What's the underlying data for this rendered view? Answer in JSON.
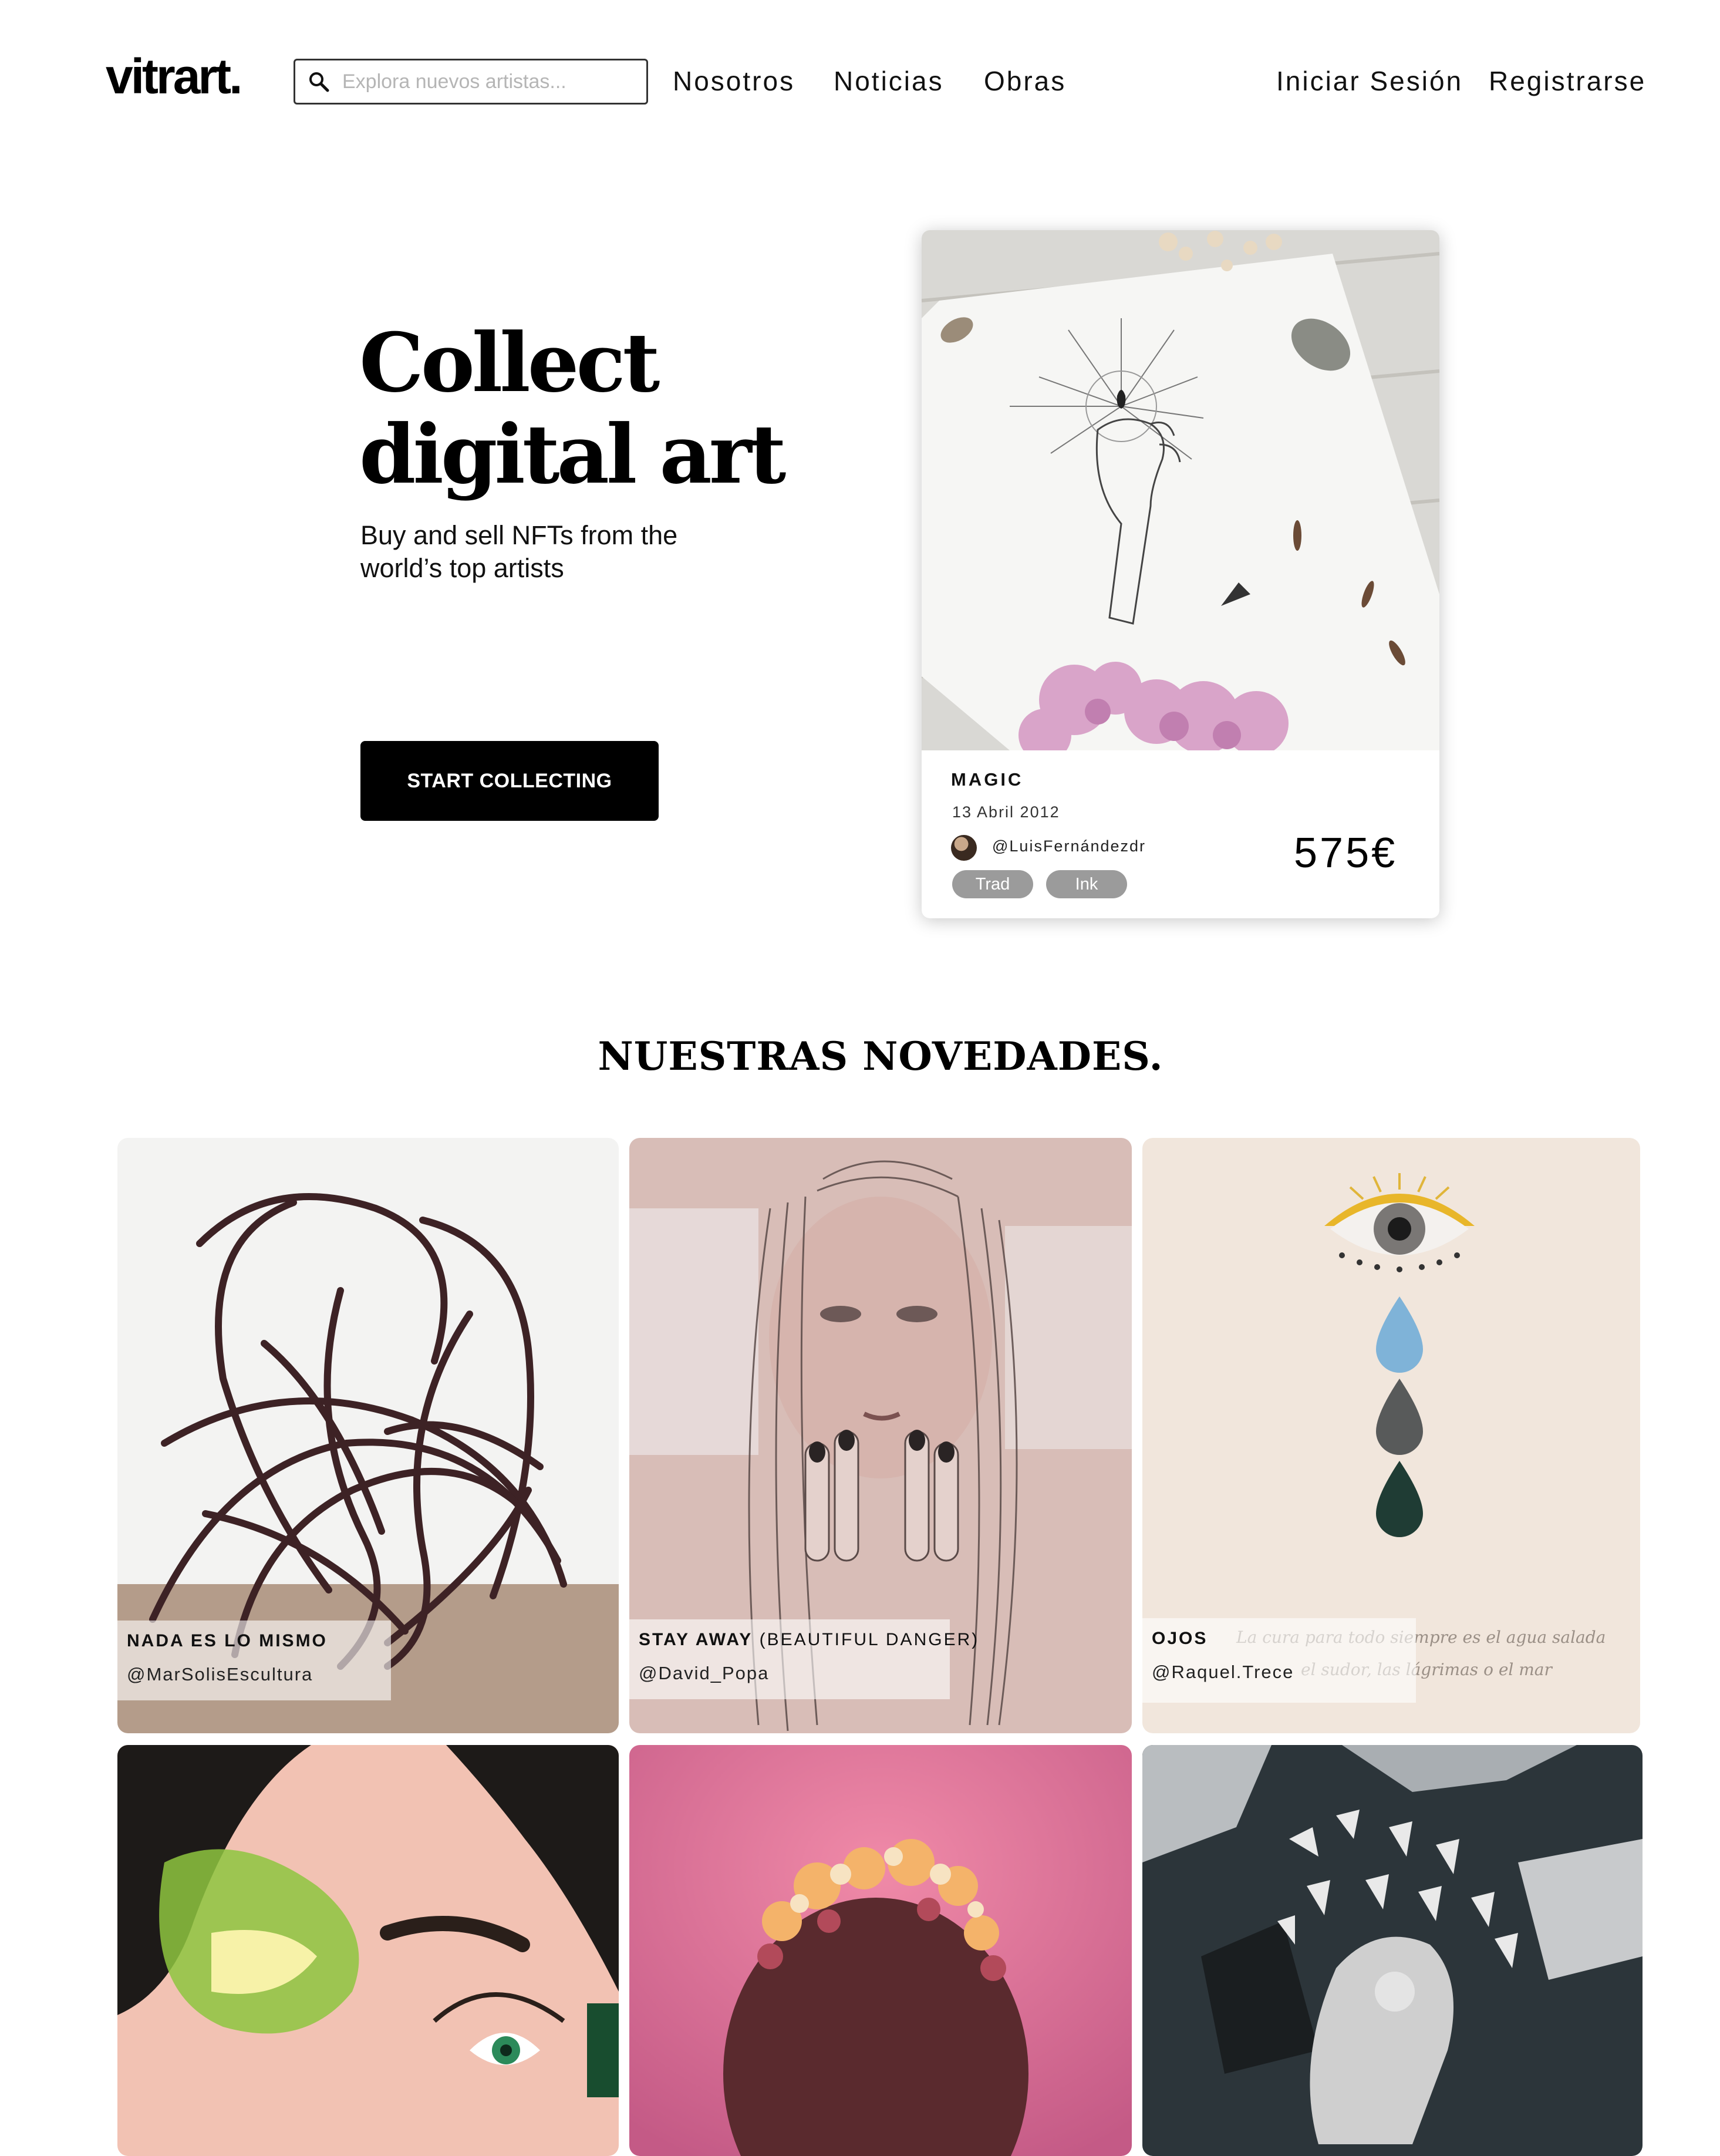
{
  "header": {
    "logo": "vitrart.",
    "search_placeholder": "Explora nuevos artistas...",
    "nav": [
      "Nosotros",
      "Noticias",
      "Obras"
    ],
    "login": "Iniciar Sesión",
    "register": "Registrarse"
  },
  "hero": {
    "title_line1": "Collect",
    "title_line2": "digital art",
    "subtitle_line1": "Buy and sell NFTs from the",
    "subtitle_line2": "world’s top artists",
    "cta": "START COLLECTING"
  },
  "featured": {
    "title": "MAGIC",
    "date": "13 Abril 2012",
    "user": "@LuisFernándezdr",
    "price": "575€",
    "tags": [
      "Trad",
      "Ink"
    ]
  },
  "novedades": {
    "title": "NUESTRAS NOVEDADES.",
    "items": [
      {
        "title": "NADA ES LO MISMO",
        "title_extra": "",
        "user": "@MarSolisEscultura"
      },
      {
        "title": "STAY AWAY",
        "title_extra": " (BEAUTIFUL DANGER)",
        "user": "@David_Popa"
      },
      {
        "title": "OJOS",
        "title_extra": "",
        "user": "@Raquel.Trece"
      }
    ]
  },
  "icons": {
    "search": "search-icon"
  }
}
